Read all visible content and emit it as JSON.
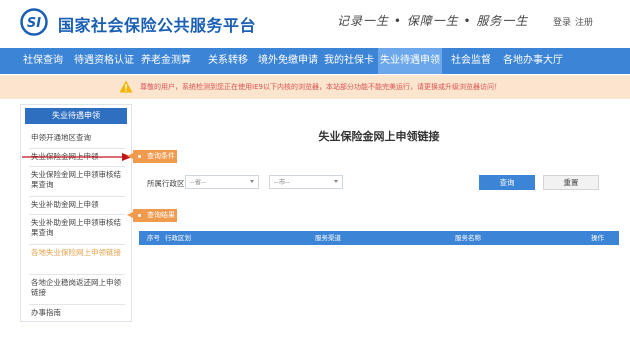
{
  "header": {
    "site_title": "国家社会保险公共服务平台",
    "slogan": "记录一生 • 保障一生 • 服务一生",
    "login": "登录",
    "register": "注册",
    "logo_icon": "si-logo-icon",
    "brand_color": "#1a5fb4"
  },
  "nav": {
    "items": [
      {
        "label": "社保查询"
      },
      {
        "label": "待遇资格认证"
      },
      {
        "label": "养老金测算"
      },
      {
        "label": "关系转移"
      },
      {
        "label": "境外免缴申请"
      },
      {
        "label": "我的社保卡"
      },
      {
        "label": "失业待遇申领"
      },
      {
        "label": "社会监督"
      },
      {
        "label": "各地办事大厅"
      }
    ],
    "active_label": "失业待遇申领",
    "bg_color": "#3c84d6"
  },
  "notice": {
    "text": "尊敬的用户，系统检测到您正在使用IE9以下内核的浏览器，本站部分功能不能完美运行，请更换或升级浏览器访问！",
    "icon": "warning-icon"
  },
  "sidebar": {
    "title": "失业待遇申领",
    "items": [
      {
        "label": "申领开通地区查询"
      },
      {
        "label": "失业保险金网上申领"
      },
      {
        "label": "失业保险金网上申领审核结果查询"
      },
      {
        "label": "失业补助金网上申领"
      },
      {
        "label": "失业补助金网上申领审核结果查询"
      },
      {
        "label": "各地失业保险网上申领链接"
      },
      {
        "label": "各地企业稳岗返还网上申领链接"
      },
      {
        "label": "办事指南"
      }
    ],
    "current_label": "各地失业保险网上申领链接"
  },
  "main": {
    "title": "失业保险金网上申领链接",
    "query_section": "查询条件",
    "filter_label": "所属行政区：",
    "select1_value": "--省--",
    "select2_value": "--市--",
    "query_button": "查询",
    "reset_button": "重置",
    "result_section": "查询结果",
    "table_headers": [
      "序号",
      "行政区划",
      "服务渠道",
      "服务名称",
      "操作"
    ],
    "accent_color": "#f09a4e"
  }
}
